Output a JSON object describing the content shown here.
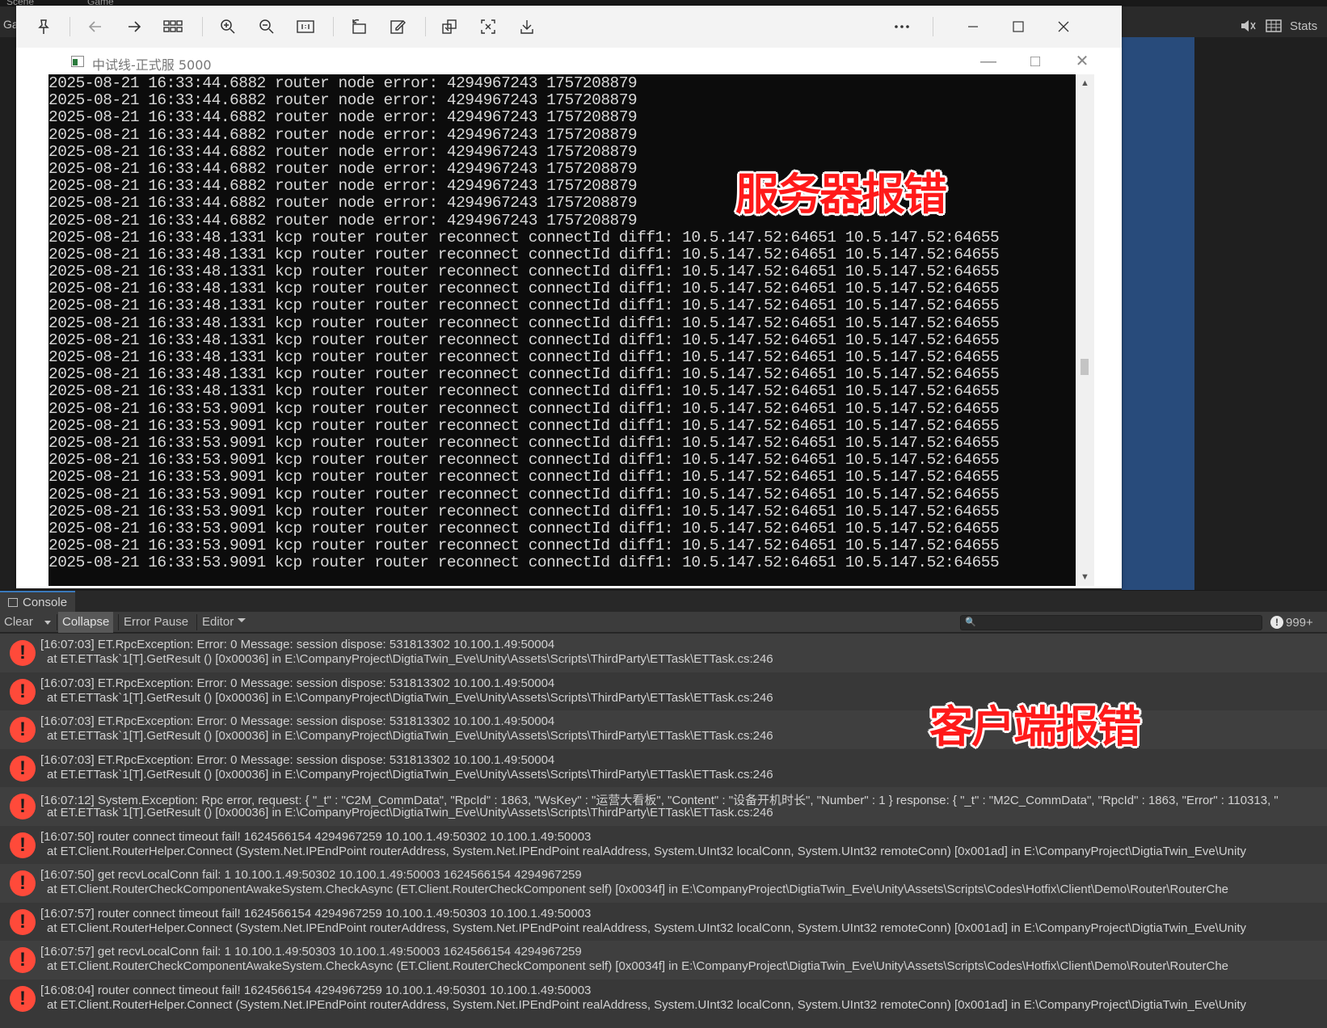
{
  "unity": {
    "top_tabs": [
      "Scene",
      "Game"
    ],
    "game_label": "Ga",
    "stats_label": "Stats"
  },
  "viewer": {
    "toolbar_icons": [
      "pin-icon",
      "back-arrow-icon",
      "forward-arrow-icon",
      "grid-icon",
      "zoom-in-icon",
      "zoom-out-icon",
      "actual-size-icon",
      "rotate-icon",
      "edit-icon",
      "convert-icon",
      "fit-icon",
      "save-icon",
      "more-icon"
    ],
    "window_controls": [
      "minimize-icon",
      "maximize-icon",
      "close-icon"
    ]
  },
  "cmd": {
    "title": "中试线-正式服 5000",
    "lines": [
      "2025-08-21 16:33:44.6882 router node error: 4294967243 1757208879",
      "2025-08-21 16:33:44.6882 router node error: 4294967243 1757208879",
      "2025-08-21 16:33:44.6882 router node error: 4294967243 1757208879",
      "2025-08-21 16:33:44.6882 router node error: 4294967243 1757208879",
      "2025-08-21 16:33:44.6882 router node error: 4294967243 1757208879",
      "2025-08-21 16:33:44.6882 router node error: 4294967243 1757208879",
      "2025-08-21 16:33:44.6882 router node error: 4294967243 1757208879",
      "2025-08-21 16:33:44.6882 router node error: 4294967243 1757208879",
      "2025-08-21 16:33:44.6882 router node error: 4294967243 1757208879",
      "2025-08-21 16:33:48.1331 kcp router router reconnect connectId diff1: 10.5.147.52:64651 10.5.147.52:64655",
      "2025-08-21 16:33:48.1331 kcp router router reconnect connectId diff1: 10.5.147.52:64651 10.5.147.52:64655",
      "2025-08-21 16:33:48.1331 kcp router router reconnect connectId diff1: 10.5.147.52:64651 10.5.147.52:64655",
      "2025-08-21 16:33:48.1331 kcp router router reconnect connectId diff1: 10.5.147.52:64651 10.5.147.52:64655",
      "2025-08-21 16:33:48.1331 kcp router router reconnect connectId diff1: 10.5.147.52:64651 10.5.147.52:64655",
      "2025-08-21 16:33:48.1331 kcp router router reconnect connectId diff1: 10.5.147.52:64651 10.5.147.52:64655",
      "2025-08-21 16:33:48.1331 kcp router router reconnect connectId diff1: 10.5.147.52:64651 10.5.147.52:64655",
      "2025-08-21 16:33:48.1331 kcp router router reconnect connectId diff1: 10.5.147.52:64651 10.5.147.52:64655",
      "2025-08-21 16:33:48.1331 kcp router router reconnect connectId diff1: 10.5.147.52:64651 10.5.147.52:64655",
      "2025-08-21 16:33:48.1331 kcp router router reconnect connectId diff1: 10.5.147.52:64651 10.5.147.52:64655",
      "2025-08-21 16:33:53.9091 kcp router router reconnect connectId diff1: 10.5.147.52:64651 10.5.147.52:64655",
      "2025-08-21 16:33:53.9091 kcp router router reconnect connectId diff1: 10.5.147.52:64651 10.5.147.52:64655",
      "2025-08-21 16:33:53.9091 kcp router router reconnect connectId diff1: 10.5.147.52:64651 10.5.147.52:64655",
      "2025-08-21 16:33:53.9091 kcp router router reconnect connectId diff1: 10.5.147.52:64651 10.5.147.52:64655",
      "2025-08-21 16:33:53.9091 kcp router router reconnect connectId diff1: 10.5.147.52:64651 10.5.147.52:64655",
      "2025-08-21 16:33:53.9091 kcp router router reconnect connectId diff1: 10.5.147.52:64651 10.5.147.52:64655",
      "2025-08-21 16:33:53.9091 kcp router router reconnect connectId diff1: 10.5.147.52:64651 10.5.147.52:64655",
      "2025-08-21 16:33:53.9091 kcp router router reconnect connectId diff1: 10.5.147.52:64651 10.5.147.52:64655",
      "2025-08-21 16:33:53.9091 kcp router router reconnect connectId diff1: 10.5.147.52:64651 10.5.147.52:64655",
      "2025-08-21 16:33:53.9091 kcp router router reconnect connectId diff1: 10.5.147.52:64651 10.5.147.52:64655"
    ]
  },
  "annotations": {
    "server": "服务器报错",
    "client": "客户端报错",
    "color": "#ff1a1a"
  },
  "console": {
    "tab_label": "Console",
    "toolbar": {
      "clear": "Clear",
      "collapse": "Collapse",
      "error_pause": "Error Pause",
      "editor": "Editor",
      "search_value": "",
      "error_count": "999+"
    },
    "entries": [
      {
        "line1": "[16:07:03] ET.RpcException: Error: 0 Message: session dispose: 531813302 10.100.1.49:50004",
        "line2": "at ET.ETTask`1[T].GetResult () [0x00036] in E:\\CompanyProject\\DigtiaTwin_Eve\\Unity\\Assets\\Scripts\\ThirdParty\\ETTask\\ETTask.cs:246"
      },
      {
        "line1": "[16:07:03] ET.RpcException: Error: 0 Message: session dispose: 531813302 10.100.1.49:50004",
        "line2": "at ET.ETTask`1[T].GetResult () [0x00036] in E:\\CompanyProject\\DigtiaTwin_Eve\\Unity\\Assets\\Scripts\\ThirdParty\\ETTask\\ETTask.cs:246"
      },
      {
        "line1": "[16:07:03] ET.RpcException: Error: 0 Message: session dispose: 531813302 10.100.1.49:50004",
        "line2": "at ET.ETTask`1[T].GetResult () [0x00036] in E:\\CompanyProject\\DigtiaTwin_Eve\\Unity\\Assets\\Scripts\\ThirdParty\\ETTask\\ETTask.cs:246"
      },
      {
        "line1": "[16:07:03] ET.RpcException: Error: 0 Message: session dispose: 531813302 10.100.1.49:50004",
        "line2": "at ET.ETTask`1[T].GetResult () [0x00036] in E:\\CompanyProject\\DigtiaTwin_Eve\\Unity\\Assets\\Scripts\\ThirdParty\\ETTask\\ETTask.cs:246"
      },
      {
        "line1": "[16:07:12] System.Exception: Rpc error, request: { \"_t\" : \"C2M_CommData\", \"RpcId\" : 1863, \"WsKey\" : \"运营大看板\", \"Content\" : \"设备开机时长\", \"Number\" : 1 } response: { \"_t\" : \"M2C_CommData\", \"RpcId\" : 1863, \"Error\" : 110313, \"",
        "line2": "at ET.ETTask`1[T].GetResult () [0x00036] in E:\\CompanyProject\\DigtiaTwin_Eve\\Unity\\Assets\\Scripts\\ThirdParty\\ETTask\\ETTask.cs:246"
      },
      {
        "line1": "[16:07:50] router connect timeout fail! 1624566154 4294967259 10.100.1.49:50302 10.100.1.49:50003",
        "line2": "at ET.Client.RouterHelper.Connect (System.Net.IPEndPoint routerAddress, System.Net.IPEndPoint realAddress, System.UInt32 localConn, System.UInt32 remoteConn) [0x001ad] in E:\\CompanyProject\\DigtiaTwin_Eve\\Unity"
      },
      {
        "line1": "[16:07:50] get recvLocalConn fail: 1 10.100.1.49:50302 10.100.1.49:50003 1624566154 4294967259",
        "line2": "at ET.Client.RouterCheckComponentAwakeSystem.CheckAsync (ET.Client.RouterCheckComponent self) [0x0034f] in E:\\CompanyProject\\DigtiaTwin_Eve\\Unity\\Assets\\Scripts\\Codes\\Hotfix\\Client\\Demo\\Router\\RouterChe"
      },
      {
        "line1": "[16:07:57] router connect timeout fail! 1624566154 4294967259 10.100.1.49:50303 10.100.1.49:50003",
        "line2": "at ET.Client.RouterHelper.Connect (System.Net.IPEndPoint routerAddress, System.Net.IPEndPoint realAddress, System.UInt32 localConn, System.UInt32 remoteConn) [0x001ad] in E:\\CompanyProject\\DigtiaTwin_Eve\\Unity"
      },
      {
        "line1": "[16:07:57] get recvLocalConn fail: 1 10.100.1.49:50303 10.100.1.49:50003 1624566154 4294967259",
        "line2": "at ET.Client.RouterCheckComponentAwakeSystem.CheckAsync (ET.Client.RouterCheckComponent self) [0x0034f] in E:\\CompanyProject\\DigtiaTwin_Eve\\Unity\\Assets\\Scripts\\Codes\\Hotfix\\Client\\Demo\\Router\\RouterChe"
      },
      {
        "line1": "[16:08:04] router connect timeout fail! 1624566154 4294967259 10.100.1.49:50301 10.100.1.49:50003",
        "line2": "at ET.Client.RouterHelper.Connect (System.Net.IPEndPoint routerAddress, System.Net.IPEndPoint realAddress, System.UInt32 localConn, System.UInt32 remoteConn) [0x001ad] in E:\\CompanyProject\\DigtiaTwin_Eve\\Unity"
      }
    ]
  }
}
